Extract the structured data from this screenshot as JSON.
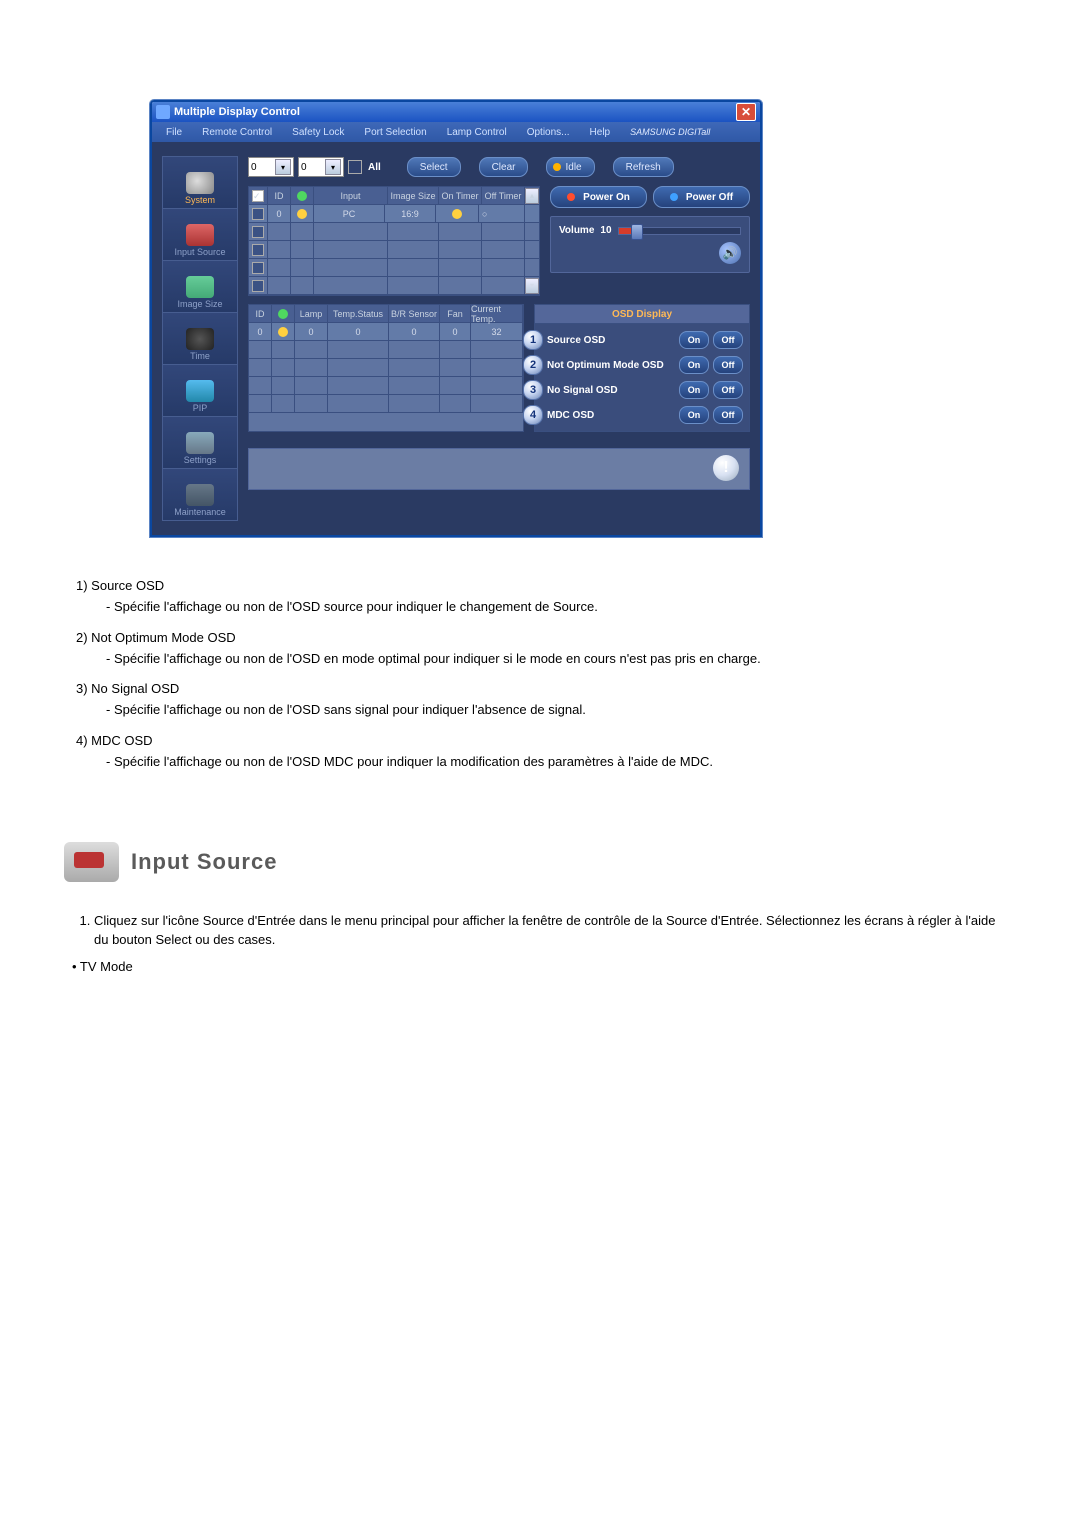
{
  "window": {
    "title": "Multiple Display Control"
  },
  "menu": {
    "items": [
      "File",
      "Remote Control",
      "Safety Lock",
      "Port Selection",
      "Lamp Control",
      "Options...",
      "Help"
    ],
    "brand": "SAMSUNG DIGITall"
  },
  "toolbar": {
    "dd1": "0",
    "dd2": "0",
    "all": "All",
    "select": "Select",
    "clear": "Clear",
    "idle": "Idle",
    "refresh": "Refresh"
  },
  "sidebar": {
    "items": [
      {
        "label": "System",
        "bright": true
      },
      {
        "label": "Input Source"
      },
      {
        "label": "Image Size"
      },
      {
        "label": "Time"
      },
      {
        "label": "PIP"
      },
      {
        "label": "Settings"
      },
      {
        "label": "Maintenance"
      }
    ]
  },
  "grid1": {
    "headers": [
      "",
      "ID",
      "",
      "Input",
      "Image Size",
      "On Timer",
      "Off Timer"
    ],
    "row": {
      "id": "0",
      "input": "PC",
      "image": "16:9"
    }
  },
  "power": {
    "on": "Power On",
    "off": "Power Off"
  },
  "volume": {
    "label": "Volume",
    "value": "10"
  },
  "grid2": {
    "headers": [
      "ID",
      "",
      "Lamp",
      "Temp.Status",
      "B/R Sensor",
      "Fan",
      "Current Temp."
    ],
    "row": {
      "id": "0",
      "lamp": "0",
      "ts": "0",
      "br": "0",
      "fan": "0",
      "ct": "32"
    }
  },
  "osd": {
    "title": "OSD Display",
    "rows": [
      {
        "n": "1",
        "label": "Source OSD"
      },
      {
        "n": "2",
        "label": "Not Optimum Mode OSD"
      },
      {
        "n": "3",
        "label": "No Signal OSD"
      },
      {
        "n": "4",
        "label": "MDC OSD"
      }
    ],
    "on": "On",
    "off": "Off"
  },
  "doc": {
    "items": [
      {
        "h": "1)  Source OSD",
        "d": "- Spécifie l'affichage ou non de l'OSD source pour indiquer le changement de Source."
      },
      {
        "h": "2)  Not Optimum Mode OSD",
        "d": "- Spécifie l'affichage ou non de l'OSD en mode optimal pour indiquer si le mode en cours n'est pas pris en charge."
      },
      {
        "h": "3)  No Signal OSD",
        "d": "- Spécifie l'affichage ou non de l'OSD sans signal pour indiquer l'absence de signal."
      },
      {
        "h": "4)  MDC OSD",
        "d": "- Spécifie l'affichage ou non de l'OSD MDC pour indiquer la modification des paramètres à l'aide de MDC."
      }
    ],
    "section": "Input Source",
    "step1": "Cliquez sur l'icône Source d'Entrée dans le menu principal pour afficher la fenêtre de contrôle de la Source d'Entrée. Sélectionnez les écrans à régler à l'aide du bouton Select ou des cases.",
    "bullet": "•  TV Mode"
  }
}
